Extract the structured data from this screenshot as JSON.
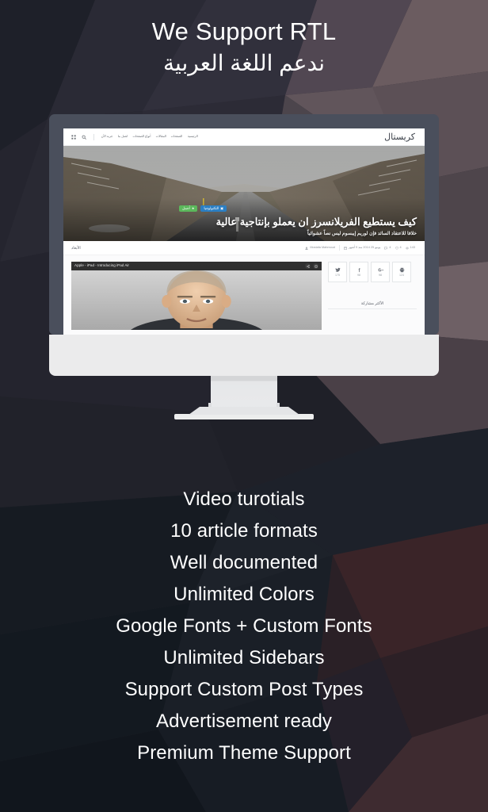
{
  "header": {
    "title_en": "We Support RTL",
    "title_ar": "ندعم اللغة العربية"
  },
  "colors": {
    "badge_green": "#5cb85c",
    "badge_blue": "#2b7fc4",
    "monitor_bezel": "#4a4f5c",
    "monitor_chin": "#ebebec",
    "text_white": "#ffffff"
  },
  "mockup": {
    "site": {
      "logo": "كريستال",
      "nav": [
        {
          "label": "الرئيسية"
        },
        {
          "label": "الصفحات"
        },
        {
          "label": "المقالات"
        },
        {
          "label": "أنواع الصفحات"
        },
        {
          "label": "اتصل بنا"
        },
        {
          "label": "جربه الآن"
        }
      ],
      "icons": {
        "search": "search-icon",
        "grid": "grid-icon"
      }
    },
    "hero": {
      "badges": [
        {
          "label": "أجمل",
          "color": "#5cb85c",
          "icon": "star-icon"
        },
        {
          "label": "التكنولوجيا",
          "color": "#2b7fc4",
          "icon": "monitor-icon"
        }
      ],
      "title": "كيف يستطيع الفريلانسرز ان يعملو بإنتاجية عالية",
      "subtitle": "خلافا للاعتقاد السائد فإن لوريم إيبسوم ليس نصاً عشوائياً"
    },
    "meta": {
      "author": "Mostafa Mahmoud",
      "date": "يونيو 25 2014 منذ 9 أشهر",
      "comments": "4",
      "likes": "4",
      "views": "143",
      "tag": "الأبعاد"
    },
    "share": {
      "heading": "الأكثر مشاركة",
      "buttons": [
        {
          "network": "twitter-icon",
          "count": "175"
        },
        {
          "network": "facebook-icon",
          "count": "98"
        },
        {
          "network": "googleplus-icon",
          "count": "98"
        },
        {
          "network": "print-icon",
          "count": "124"
        }
      ]
    },
    "video": {
      "title": "Apple - iPad - Introducing iPad Air",
      "actions": [
        {
          "icon": "share-icon"
        },
        {
          "icon": "info-icon"
        }
      ]
    }
  },
  "features": [
    {
      "label": "Video turotials"
    },
    {
      "label": "10 article formats"
    },
    {
      "label": "Well documented"
    },
    {
      "label": "Unlimited Colors"
    },
    {
      "label": "Google Fonts + Custom Fonts"
    },
    {
      "label": "Unlimited Sidebars"
    },
    {
      "label": "Support Custom Post Types"
    },
    {
      "label": "Advertisement ready"
    },
    {
      "label": "Premium Theme Support"
    }
  ]
}
